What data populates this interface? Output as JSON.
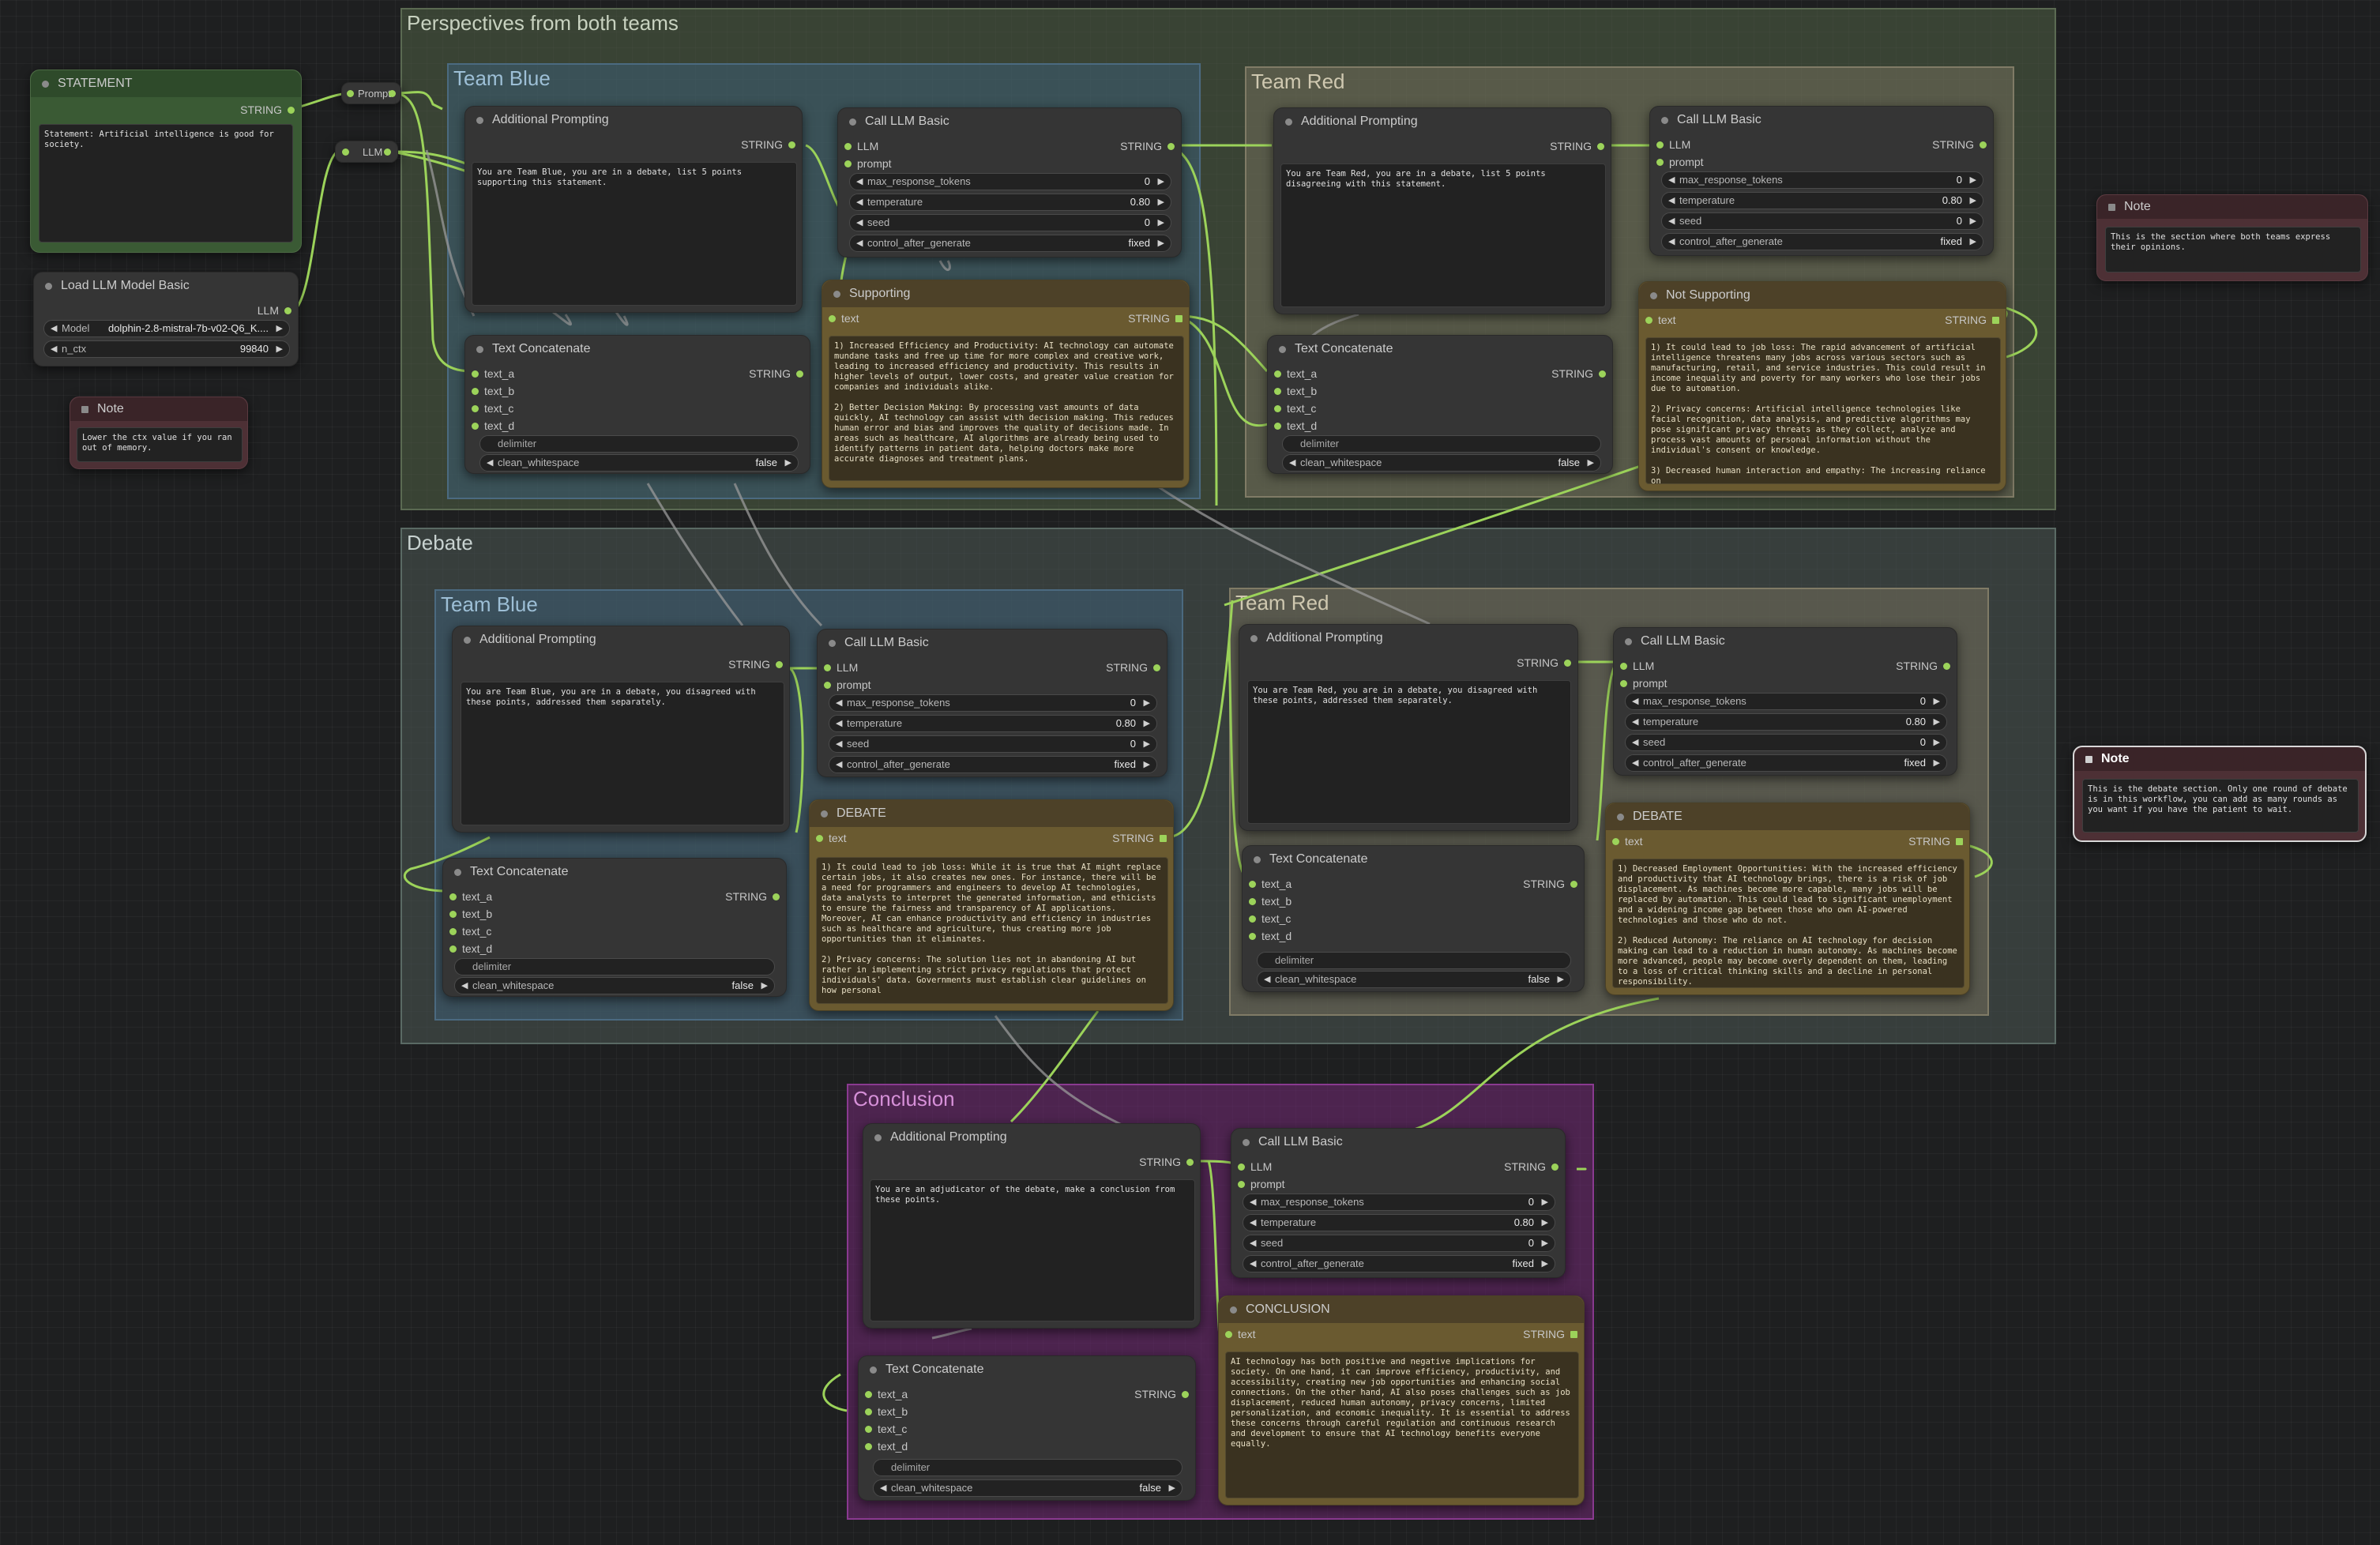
{
  "groups": {
    "perspectives": "Perspectives from both teams",
    "team_blue_1": "Team Blue",
    "team_red_1": "Team Red",
    "debate": "Debate",
    "team_blue_2": "Team Blue",
    "team_red_2": "Team Red",
    "conclusion": "Conclusion"
  },
  "labels": {
    "statement": "STATEMENT",
    "string": "STRING",
    "llm": "LLM",
    "prompt": "prompt",
    "text": "text",
    "text_a": "text_a",
    "text_b": "text_b",
    "text_c": "text_c",
    "text_d": "text_d",
    "delimiter": "delimiter",
    "clean_whitespace": "clean_whitespace",
    "false": "false",
    "max_response_tokens": "max_response_tokens",
    "temperature": "temperature",
    "seed": "seed",
    "control_after_generate": "control_after_generate",
    "fixed": "fixed",
    "zero": "0",
    "temp_value": "0.80",
    "additional_prompting": "Additional Prompting",
    "call_llm_basic": "Call LLM Basic",
    "text_concatenate": "Text Concatenate",
    "load_llm": "Load LLM Model Basic",
    "model": "Model",
    "n_ctx": "n_ctx",
    "note": "Note",
    "prompt_reroute": "Prompt",
    "llm_reroute": "LLM",
    "supporting": "Supporting",
    "not_supporting": "Not Supporting",
    "debate_title": "DEBATE",
    "conclusion_title": "CONCLUSION"
  },
  "statement_node": {
    "text": "Statement: Artificial intelligence is good for society."
  },
  "load_llm_node": {
    "model_value": "dolphin-2.8-mistral-7b-v02-Q6_K....",
    "n_ctx_value": "99840"
  },
  "notes": {
    "ctx": "Lower the ctx value if you ran out of memory.",
    "perspectives": "This is the section where both teams express their opinions.",
    "debate": "This is the debate section. Only one round of debate is in this workflow, you can add as many rounds as you want if you have the patient to wait."
  },
  "prompts": {
    "blue_1": "You are Team Blue, you are in a debate, list 5 points supporting this statement.",
    "red_1": "You are Team Red, you are in a debate, list 5 points disagreeing with this statement.",
    "blue_2": "You are Team Blue, you are in a debate, you disagreed with these points, addressed them separately.",
    "red_2": "You are Team Red, you are in a debate, you disagreed with these points, addressed them separately.",
    "conclusion": "You are an adjudicator of the debate, make a conclusion from these points."
  },
  "outputs": {
    "supporting": "1) Increased Efficiency and Productivity: AI technology can automate mundane tasks and free up time for more complex and creative work, leading to increased efficiency and productivity. This results in higher levels of output, lower costs, and greater value creation for companies and individuals alike.\n\n2) Better Decision Making: By processing vast amounts of data quickly, AI technology can assist with decision making. This reduces human error and bias and improves the quality of decisions made. In areas such as healthcare, AI algorithms are already being used to identify patterns in patient data, helping doctors make more accurate diagnoses and treatment plans.",
    "not_supporting": "1) It could lead to job loss: The rapid advancement of artificial intelligence threatens many jobs across various sectors such as manufacturing, retail, and service industries. This could result in income inequality and poverty for many workers who lose their jobs due to automation.\n\n2) Privacy concerns: Artificial intelligence technologies like facial recognition, data analysis, and predictive algorithms may pose significant privacy threats as they collect, analyze and process vast amounts of personal information without the individual's consent or knowledge.\n\n3) Decreased human interaction and empathy: The increasing reliance on",
    "debate_blue": "1) It could lead to job loss: While it is true that AI might replace certain jobs, it also creates new ones. For instance, there will be a need for programmers and engineers to develop AI technologies, data analysts to interpret the generated information, and ethicists to ensure the fairness and transparency of AI applications. Moreover, AI can enhance productivity and efficiency in industries such as healthcare and agriculture, thus creating more job opportunities than it eliminates.\n\n2) Privacy concerns: The solution lies not in abandoning AI but rather in implementing strict privacy regulations that protect individuals' data. Governments must establish clear guidelines on how personal",
    "debate_red": "1) Decreased Employment Opportunities: With the increased efficiency and productivity that AI technology brings, there is a risk of job displacement. As machines become more capable, many jobs will be replaced by automation. This could lead to significant unemployment and a widening income gap between those who own AI-powered technologies and those who do not.\n\n2) Reduced Autonomy: The reliance on AI technology for decision making can lead to a reduction in human autonomy. As machines become more advanced, people may become overly dependent on them, leading to a loss of critical thinking skills and a decline in personal responsibility.",
    "conclusion": "AI technology has both positive and negative implications for society. On one hand, it can improve efficiency, productivity, and accessibility, creating new job opportunities and enhancing social connections. On the other hand, AI also poses challenges such as job displacement, reduced human autonomy, privacy concerns, limited personalization, and economic inequality. It is essential to address these concerns through careful regulation and continuous research and development to ensure that AI technology benefits everyone equally."
  },
  "colors": {
    "wire": "#9cd35a",
    "group_perspectives": "#4c5a44",
    "group_blue": "#3d5a6e",
    "group_red": "#676457",
    "group_debate": "#46544f",
    "group_conclusion": "#6a2a6e",
    "node_bg": "#353535",
    "output_bg": "#6a5a30",
    "note_bg": "#4d3035",
    "statement_bg": "#2e4a2a"
  },
  "icons": {
    "arrow_left": "◀",
    "arrow_right": "▶"
  }
}
